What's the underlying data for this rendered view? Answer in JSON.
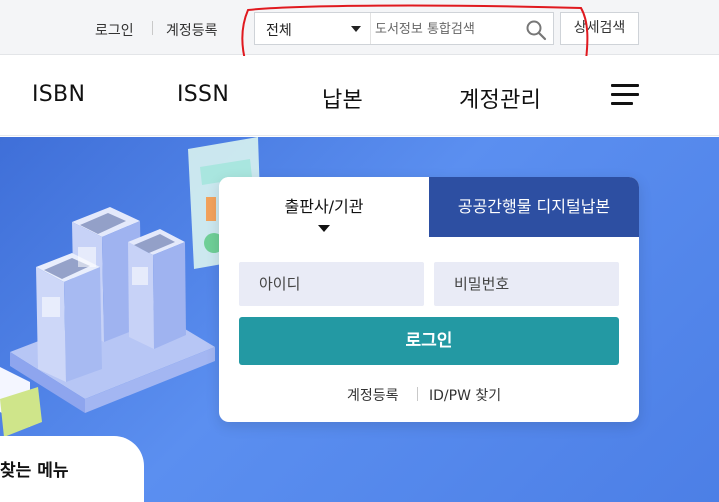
{
  "util": {
    "login": "로그인",
    "register": "계정등록",
    "search": {
      "category": "전체",
      "placeholder": "도서정보 통합검색",
      "advanced": "상세검색"
    }
  },
  "nav": {
    "items": [
      "ISBN",
      "ISSN",
      "납본",
      "계정관리"
    ]
  },
  "login_card": {
    "tabs": [
      "출판사/기관",
      "공공간행물 디지털납본"
    ],
    "id_placeholder": "아이디",
    "pw_placeholder": "비밀번호",
    "submit": "로그인",
    "register": "계정등록",
    "find": "ID/PW 찾기"
  },
  "quick_menu": {
    "title": "찾는 메뉴"
  },
  "colors": {
    "tab_active_bg": "#ffffff",
    "tab_inactive_bg": "#2d4fa2",
    "login_button": "#2399a3",
    "hero_bg": "#4c7fe6",
    "annotation": "#e0191f"
  }
}
